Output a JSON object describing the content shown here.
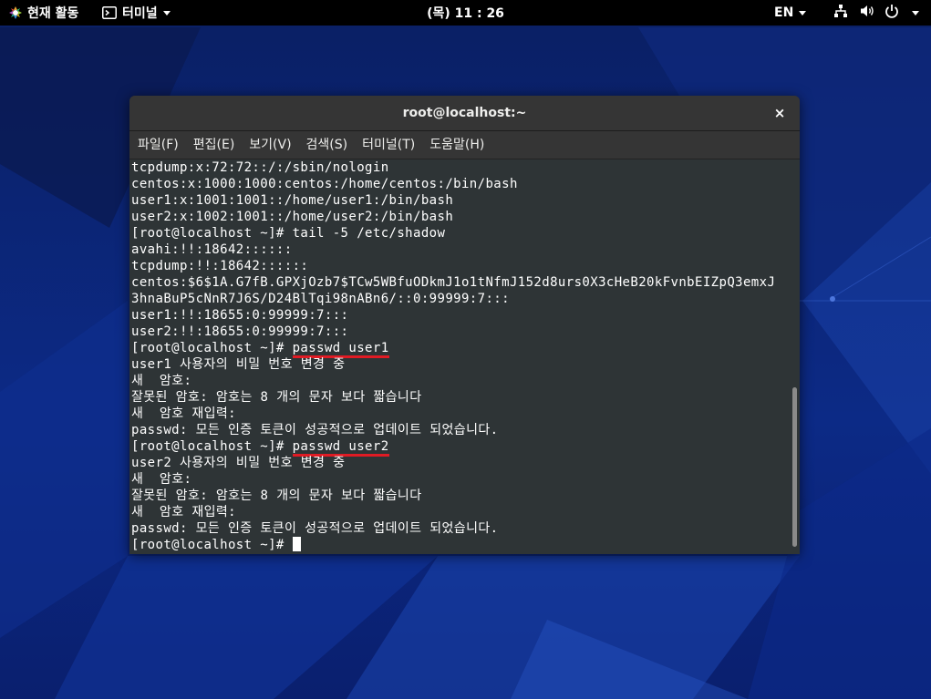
{
  "topbar": {
    "activities_label": "현재 활동",
    "app_menu_label": "터미널",
    "clock": "(목) 11 : 26",
    "lang": "EN"
  },
  "window": {
    "title": "root@localhost:~",
    "close_glyph": "×",
    "menu": [
      "파일(F)",
      "편집(E)",
      "보기(V)",
      "검색(S)",
      "터미널(T)",
      "도움말(H)"
    ]
  },
  "terminal": {
    "lines": [
      "tcpdump:x:72:72::/:/sbin/nologin",
      "centos:x:1000:1000:centos:/home/centos:/bin/bash",
      "user1:x:1001:1001::/home/user1:/bin/bash",
      "user2:x:1002:1001::/home/user2:/bin/bash",
      "[root@localhost ~]# tail -5 /etc/shadow",
      "avahi:!!:18642::::::",
      "tcpdump:!!:18642::::::",
      "centos:$6$1A.G7fB.GPXjOzb7$TCw5WBfuODkmJ1o1tNfmJ152d8urs0X3cHeB20kFvnbEIZpQ3emxJ",
      "3hnaBuP5cNnR7J6S/D24BlTqi98nABn6/::0:99999:7:::",
      "user1:!!:18655:0:99999:7:::",
      "user2:!!:18655:0:99999:7:::"
    ],
    "prompt": "[root@localhost ~]# ",
    "cmd1": "passwd user1",
    "block1": [
      "user1 사용자의 비밀 번호 변경 중",
      "새  암호:",
      "잘못된 암호: 암호는 8 개의 문자 보다 짧습니다",
      "새  암호 재입력:",
      "passwd: 모든 인증 토큰이 성공적으로 업데이트 되었습니다."
    ],
    "cmd2": "passwd user2",
    "block2": [
      "user2 사용자의 비밀 번호 변경 중",
      "새  암호:",
      "잘못된 암호: 암호는 8 개의 문자 보다 짧습니다",
      "새  암호 재입력:",
      "passwd: 모든 인증 토큰이 성공적으로 업데이트 되었습니다."
    ]
  },
  "icons": {
    "activities": "activities-icon",
    "terminal_app": "terminal-icon",
    "network": "network-icon",
    "volume": "volume-icon",
    "power": "power-icon"
  }
}
